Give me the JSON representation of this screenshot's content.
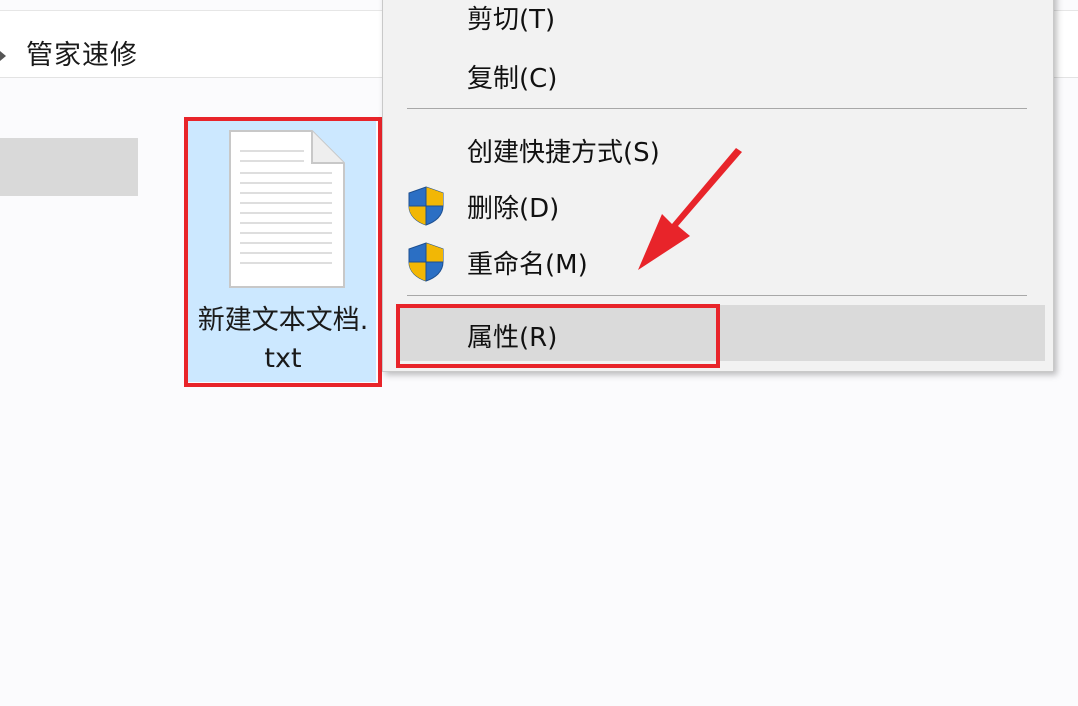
{
  "breadcrumb": {
    "path_label": "管家速修"
  },
  "file": {
    "name": "新建文本文档.txt"
  },
  "context_menu": {
    "items": [
      {
        "label": "剪切(T)",
        "icon": "none"
      },
      {
        "label": "复制(C)",
        "icon": "none"
      },
      {
        "label": "创建快捷方式(S)",
        "icon": "none"
      },
      {
        "label": "删除(D)",
        "icon": "uac-shield-icon"
      },
      {
        "label": "重命名(M)",
        "icon": "uac-shield-icon"
      },
      {
        "label": "属性(R)",
        "icon": "none"
      }
    ],
    "highlighted_item": "属性(R)"
  },
  "annotations": {
    "highlight_color": "#e8242a"
  }
}
